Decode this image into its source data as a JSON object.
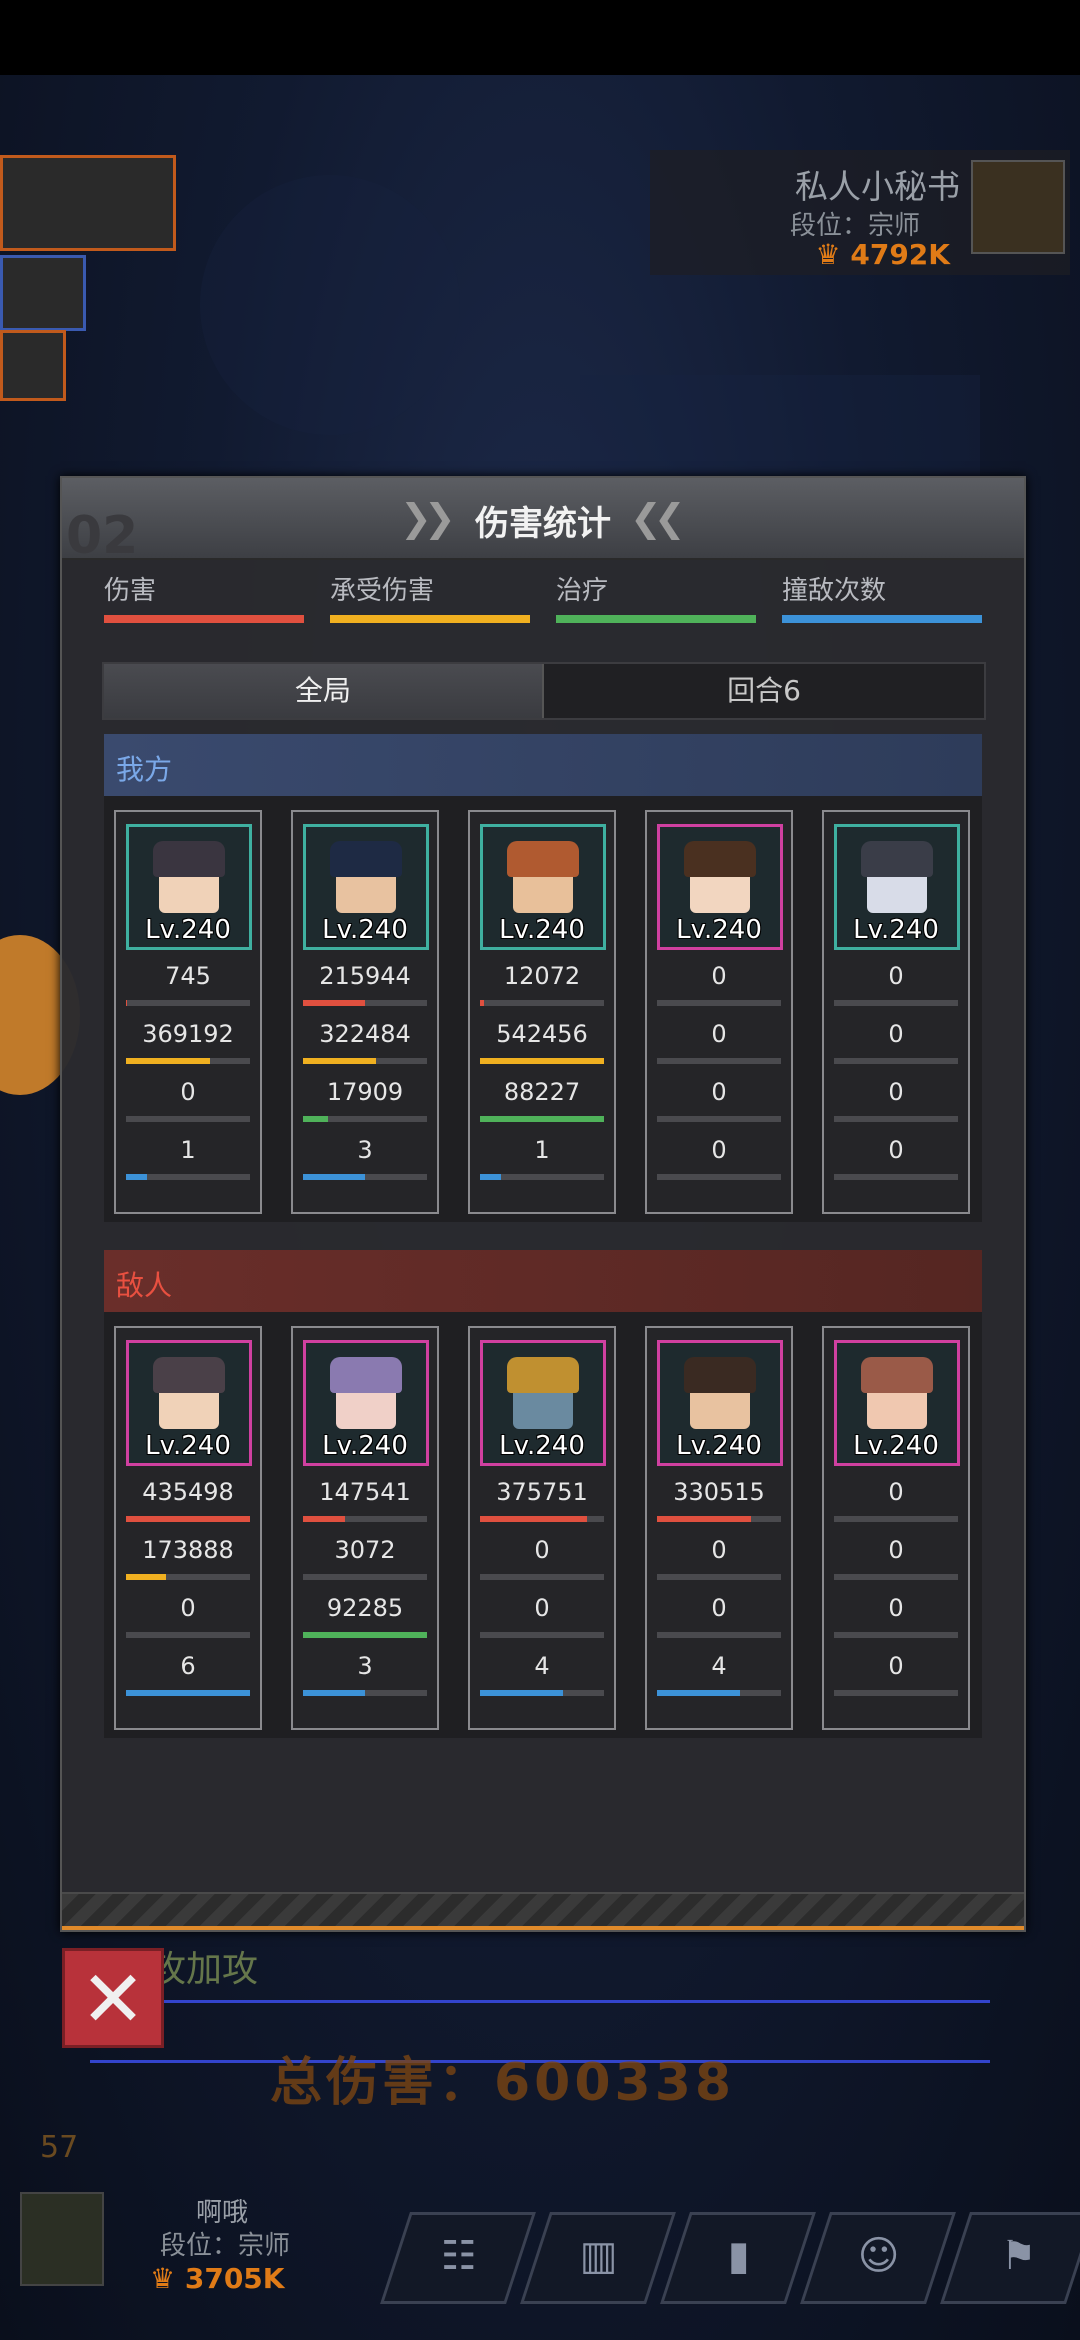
{
  "colors": {
    "damage": "#e0503f",
    "taken": "#f0b020",
    "heal": "#4fb25a",
    "hits": "#3c92d8"
  },
  "background": {
    "enemy_name": "私人小秘书",
    "enemy_rank": "段位：宗师",
    "enemy_power": "4792K",
    "user_name": "啊哦",
    "user_rank": "段位：宗师",
    "user_power": "3705K",
    "total_damage": "总伤害：600338",
    "round_num": "57",
    "attack_label": "攻加攻"
  },
  "panel": {
    "title": "伤害统计",
    "legend": [
      {
        "label": "伤害",
        "color": "#e0503f"
      },
      {
        "label": "承受伤害",
        "color": "#f0b020"
      },
      {
        "label": "治疗",
        "color": "#4fb25a"
      },
      {
        "label": "撞敌次数",
        "color": "#3c92d8"
      }
    ],
    "tabs": [
      "全局",
      "回合6"
    ],
    "ally_label": "我方",
    "enemy_label": "敌人"
  },
  "allies": [
    {
      "level": "Lv.240",
      "damage": "745",
      "taken": "369192",
      "heal": "0",
      "hits": "1",
      "fill": [
        0.003,
        0.68,
        0.0,
        0.17
      ],
      "frame": "#3fb0a0",
      "skin": "#f0d2b8",
      "hair": "#3a3540"
    },
    {
      "level": "Lv.240",
      "damage": "215944",
      "taken": "322484",
      "heal": "17909",
      "hits": "3",
      "fill": [
        0.5,
        0.59,
        0.2,
        0.5
      ],
      "frame": "#3fb0a0",
      "skin": "#e8c2a0",
      "hair": "#1e2a44"
    },
    {
      "level": "Lv.240",
      "damage": "12072",
      "taken": "542456",
      "heal": "88227",
      "hits": "1",
      "fill": [
        0.03,
        1.0,
        1.0,
        0.17
      ],
      "frame": "#3fb0a0",
      "skin": "#e8c09a",
      "hair": "#b05a30"
    },
    {
      "level": "Lv.240",
      "damage": "0",
      "taken": "0",
      "heal": "0",
      "hits": "0",
      "fill": [
        0,
        0,
        0,
        0
      ],
      "frame": "#d040a0",
      "skin": "#f2d6c0",
      "hair": "#4a3020"
    },
    {
      "level": "Lv.240",
      "damage": "0",
      "taken": "0",
      "heal": "0",
      "hits": "0",
      "fill": [
        0,
        0,
        0,
        0
      ],
      "frame": "#3fb0a0",
      "skin": "#d8dce8",
      "hair": "#3a3d48"
    }
  ],
  "enemies": [
    {
      "level": "Lv.240",
      "damage": "435498",
      "taken": "173888",
      "heal": "0",
      "hits": "6",
      "fill": [
        1.0,
        0.32,
        0.0,
        1.0
      ],
      "frame": "#d040a0",
      "skin": "#f0d2b8",
      "hair": "#4a4048"
    },
    {
      "level": "Lv.240",
      "damage": "147541",
      "taken": "3072",
      "heal": "92285",
      "hits": "3",
      "fill": [
        0.34,
        0.0,
        1.0,
        0.5
      ],
      "frame": "#d040a0",
      "skin": "#f0d0c8",
      "hair": "#8a7ab0"
    },
    {
      "level": "Lv.240",
      "damage": "375751",
      "taken": "0",
      "heal": "0",
      "hits": "4",
      "fill": [
        0.86,
        0,
        0,
        0.67
      ],
      "frame": "#d040a0",
      "skin": "#6a8aa0",
      "hair": "#c09030"
    },
    {
      "level": "Lv.240",
      "damage": "330515",
      "taken": "0",
      "heal": "0",
      "hits": "4",
      "fill": [
        0.76,
        0,
        0,
        0.67
      ],
      "frame": "#d040a0",
      "skin": "#e8c2a0",
      "hair": "#3a2a22"
    },
    {
      "level": "Lv.240",
      "damage": "0",
      "taken": "0",
      "heal": "0",
      "hits": "0",
      "fill": [
        0,
        0,
        0,
        0
      ],
      "frame": "#d040a0",
      "skin": "#f0c8b0",
      "hair": "#9a5a48"
    }
  ]
}
